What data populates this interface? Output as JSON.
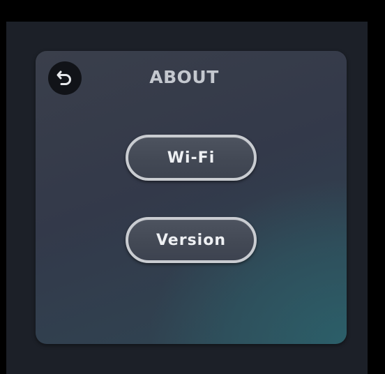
{
  "screen": {
    "title": "ABOUT",
    "back_icon": "undo-arrow-icon"
  },
  "buttons": [
    {
      "label": "Wi-Fi"
    },
    {
      "label": "Version"
    }
  ],
  "colors": {
    "background": "#1c2028",
    "panel": "#363b48",
    "panel_accent": "#2c606a",
    "button_border": "#c9ccd1",
    "title_text": "#c4c8cf",
    "button_text": "#eef0f3"
  }
}
